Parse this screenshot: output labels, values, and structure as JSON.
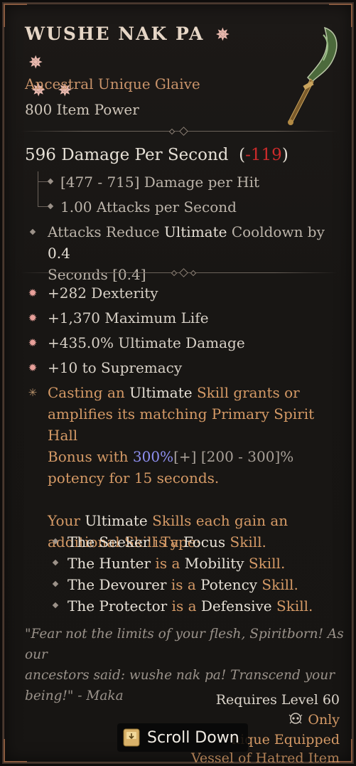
{
  "item": {
    "name": "WUSHE NAK PA",
    "name_stars": [
      "✵",
      "✵",
      "✵",
      "✵"
    ],
    "type_line": "Ancestral Unique Glaive",
    "item_power": "800 Item Power"
  },
  "stats": {
    "dps_text": "596 Damage Per Second",
    "dps_open": "(",
    "dps_delta": "-119",
    "dps_close": ")",
    "damage_per_hit": "[477 - 715] Damage per Hit",
    "attacks_per_second": "1.00 Attacks per Second",
    "implicit": {
      "part1": "Attacks Reduce ",
      "part2": "Ultimate",
      "part3": " Cooldown by ",
      "part4": "0.4",
      "line2": "Seconds [0.4]"
    }
  },
  "affixes": [
    {
      "icon": "star-affix-icon",
      "text": "+282 Dexterity"
    },
    {
      "icon": "star-affix-icon",
      "text": "+1,370 Maximum Life"
    },
    {
      "icon": "star-affix-icon",
      "text": "+435.0% Ultimate Damage"
    },
    {
      "icon": "star-affix-icon",
      "text": "+10 to Supremacy"
    }
  ],
  "unique_power": {
    "l1_a": "Casting an ",
    "l1_b": "Ultimate",
    "l1_c": " Skill grants or",
    "l2": "amplifies its matching Primary Spirit Hall",
    "l3_a": "Bonus with ",
    "l3_b": "300%",
    "l3_c": "[+]",
    "l3_d": " [200 - 300]%",
    "l4": "potency for 15 seconds.",
    "l5_a": "Your ",
    "l5_b": "Ultimate",
    "l5_c": " Skills each gain an",
    "l6": "additional Skill Type:",
    "types": [
      {
        "name": "The Seeker",
        "mid": " is a ",
        "type": "Focus",
        "end": " Skill."
      },
      {
        "name": "The Hunter",
        "mid": " is a ",
        "type": "Mobility",
        "end": " Skill."
      },
      {
        "name": "The Devourer",
        "mid": " is a ",
        "type": "Potency",
        "end": " Skill."
      },
      {
        "name": "The Protector",
        "mid": " is a ",
        "type": "Defensive",
        "end": " Skill."
      }
    ]
  },
  "flavor": {
    "l1": "\"Fear not the limits of your flesh, Spiritborn!  As our",
    "l2": "ancestors said: wushe nak pa! Transcend your",
    "l3": "being!\" - Maka"
  },
  "footer": {
    "requires": "Requires Level 60",
    "only": "Only",
    "unique_equipped": "nique Equipped",
    "vessel": "Vessel of Hatred Item"
  },
  "scroll_button": {
    "label": "Scroll Down"
  },
  "colors": {
    "accent_orange": "#d59a66",
    "negative_red": "#cc2b2b",
    "blue_value": "#8e8ff0"
  }
}
